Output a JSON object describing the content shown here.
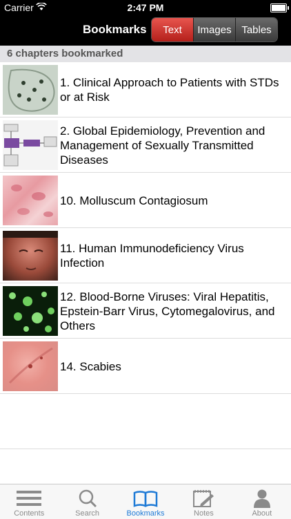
{
  "status_bar": {
    "carrier": "Carrier",
    "time": "2:47 PM"
  },
  "nav": {
    "title": "Bookmarks",
    "segments": [
      {
        "label": "Text",
        "active": true
      },
      {
        "label": "Images",
        "active": false
      },
      {
        "label": "Tables",
        "active": false
      }
    ]
  },
  "section_header": "6 chapters bookmarked",
  "bookmarks": [
    {
      "title": "1. Clinical Approach to Patients with STDs or at Risk"
    },
    {
      "title": "2. Global Epidemiology, Prevention and Management of Sexually Transmitted Diseases"
    },
    {
      "title": "10. Molluscum Contagiosum"
    },
    {
      "title": "11. Human Immunodeficiency Virus Infection"
    },
    {
      "title": "12. Blood-Borne Viruses: Viral Hepatitis, Epstein-Barr Virus, Cytomegalovirus, and Others"
    },
    {
      "title": "14. Scabies"
    }
  ],
  "tabs": [
    {
      "label": "Contents",
      "icon": "menu-lines-icon",
      "active": false
    },
    {
      "label": "Search",
      "icon": "search-icon",
      "active": false
    },
    {
      "label": "Bookmarks",
      "icon": "open-book-icon",
      "active": true
    },
    {
      "label": "Notes",
      "icon": "notepad-icon",
      "active": false
    },
    {
      "label": "About",
      "icon": "person-icon",
      "active": false
    }
  ],
  "colors": {
    "accent": "#1e7ad6",
    "active_segment": "#c9302c"
  }
}
